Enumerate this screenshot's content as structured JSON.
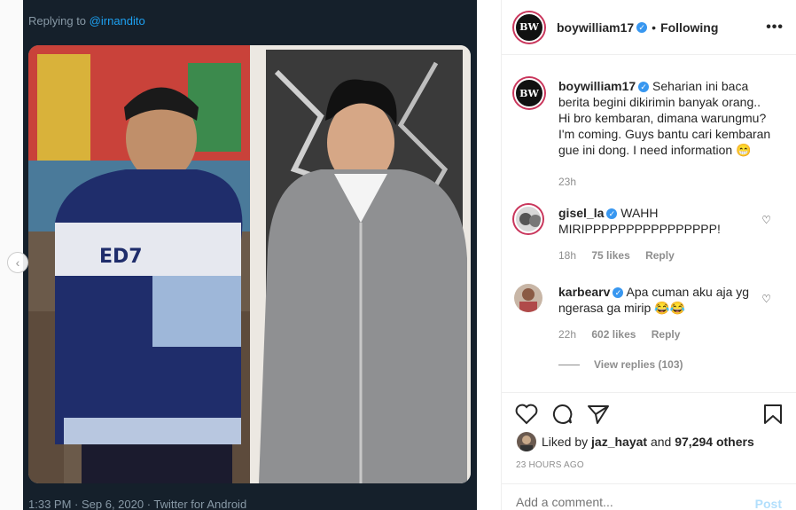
{
  "tweet": {
    "replying_prefix": "Replying to",
    "replying_handle": "@irnandito",
    "meta": "1:33 PM · Sep 6, 2020 · Twitter for Android"
  },
  "post": {
    "username": "boywilliam17",
    "follow_status": "Following",
    "avatar_text": "BW",
    "caption": "Seharian ini baca berita begini dikirimin banyak orang.. Hi bro kembaran, dimana warungmu? I'm coming. Guys bantu cari kembaran gue ini dong. I need information 😁",
    "caption_time": "23h",
    "jersey_text": "ED7"
  },
  "comments": [
    {
      "username": "gisel_la",
      "text": "WAHH MIRIPPPPPPPPPPPPPPPP!",
      "time": "18h",
      "likes": "75 likes",
      "reply": "Reply"
    },
    {
      "username": "karbearv",
      "text": "Apa cuman aku aja yg ngerasa ga mirip 😂😂",
      "time": "22h",
      "likes": "602 likes",
      "reply": "Reply",
      "view_replies": "View replies (103)"
    }
  ],
  "engagement": {
    "liked_by_prefix": "Liked by",
    "liked_by_user": "jaz_hayat",
    "and_text": "and",
    "others": "97,294 others",
    "timestamp": "23 HOURS AGO"
  },
  "composer": {
    "placeholder": "Add a comment...",
    "post_label": "Post"
  },
  "colors": {
    "accent": "#3897f0",
    "twitter_bg": "#15202b",
    "link": "#1da1f2"
  }
}
